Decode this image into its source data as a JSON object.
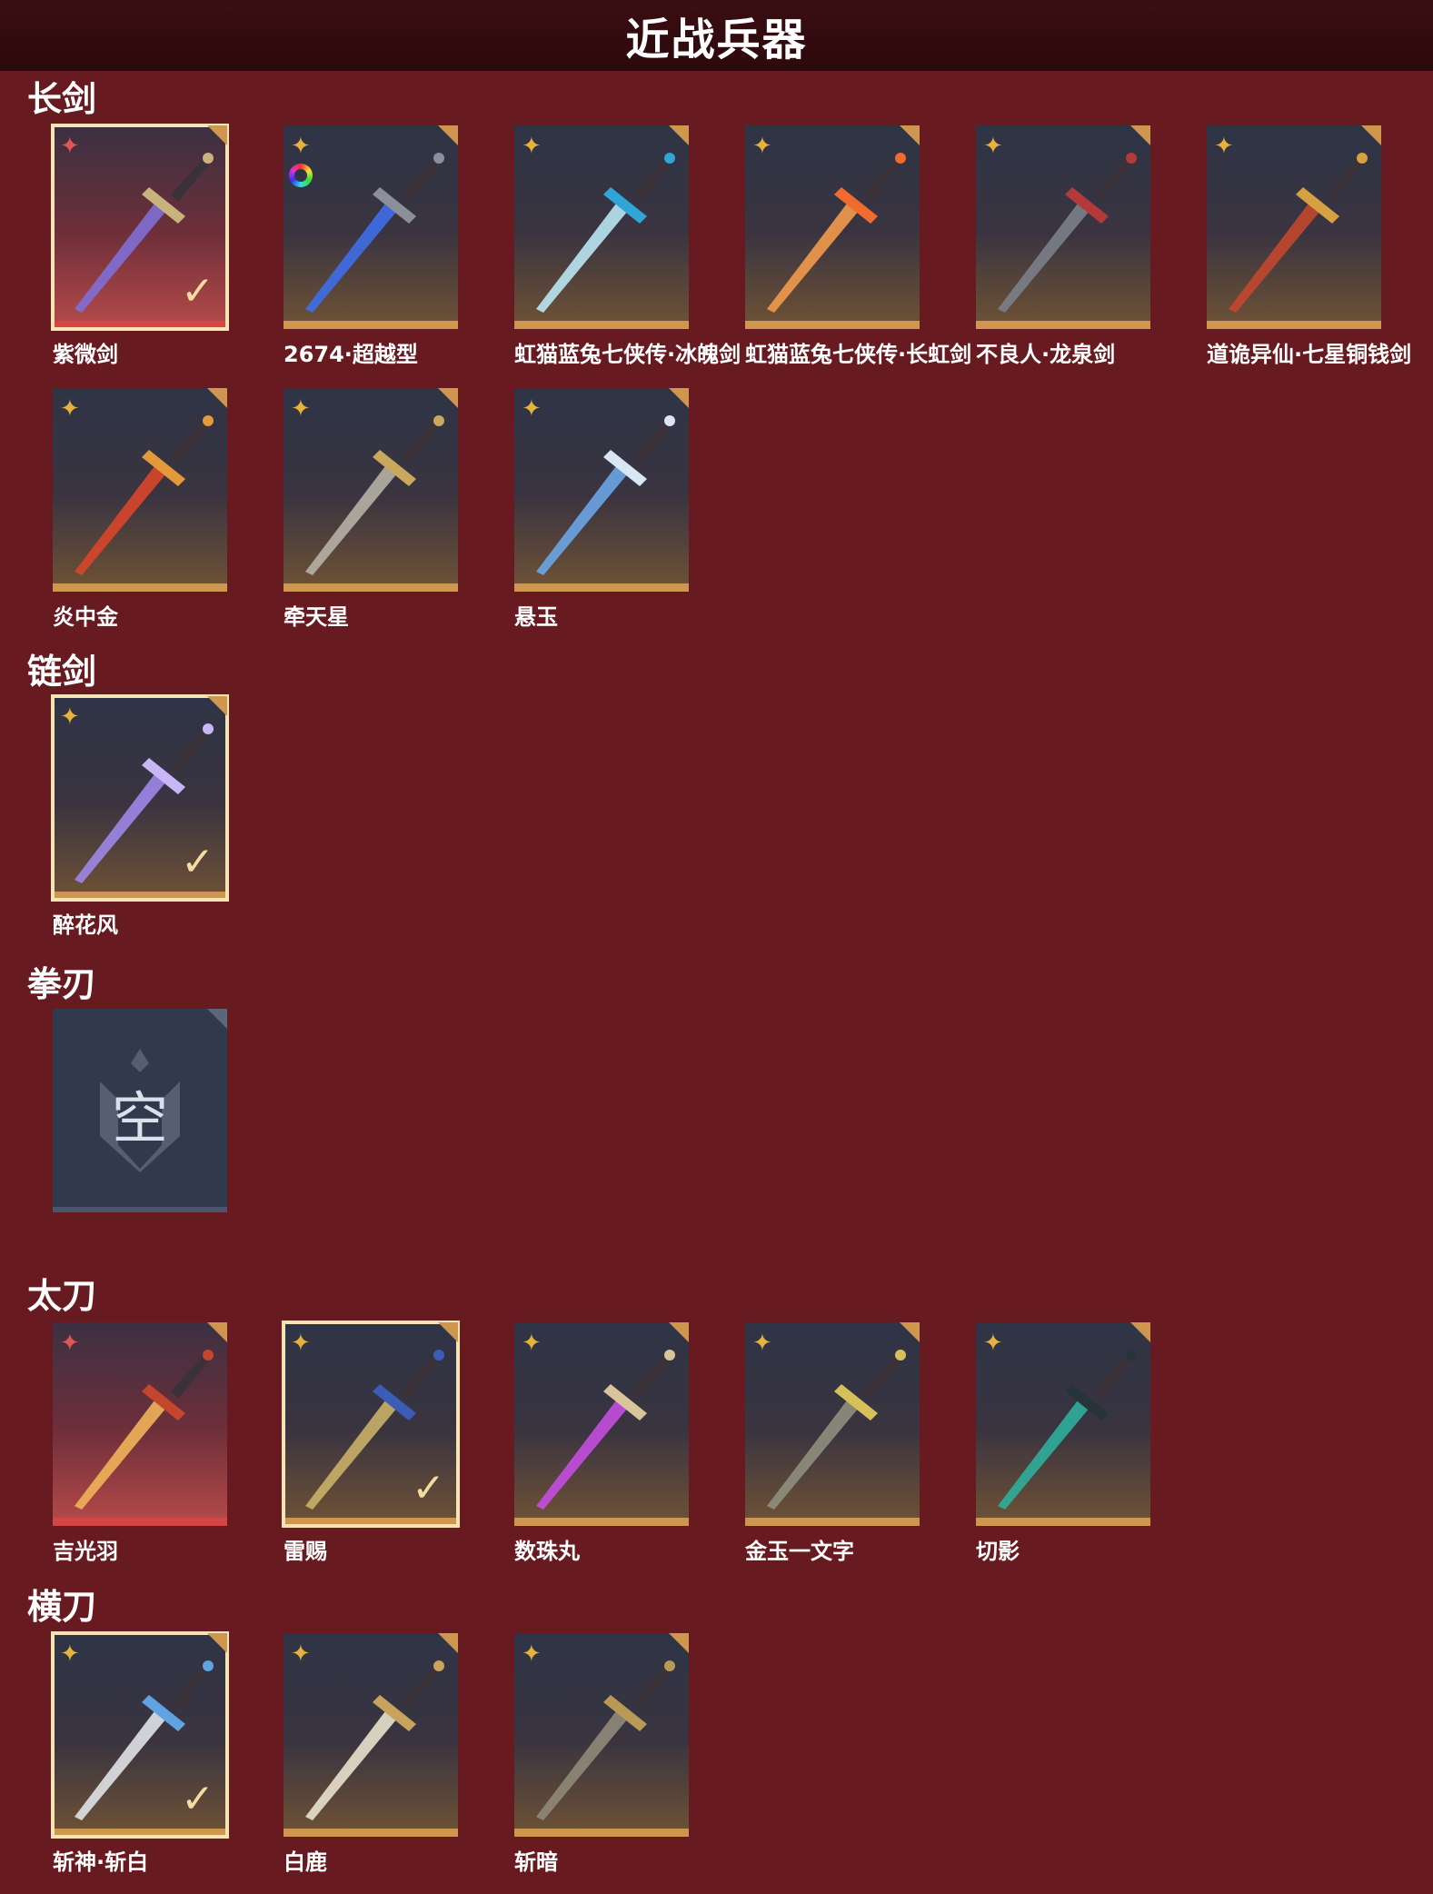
{
  "header": {
    "title": "近战兵器"
  },
  "sections": [
    {
      "title": "长剑",
      "items": [
        {
          "name": "紫微剑",
          "rarity": "red",
          "selected": true,
          "blade": "#7f6fd6",
          "guard": "#c9b37d"
        },
        {
          "name": "2674·超越型",
          "rarity": "gold",
          "selected": false,
          "color_ring": true,
          "blade": "#3f6ee8",
          "guard": "#8a8f9a"
        },
        {
          "name": "虹猫蓝兔七侠传·冰魄剑",
          "rarity": "gold",
          "selected": false,
          "blade": "#b9e6f2",
          "guard": "#2fa6d6"
        },
        {
          "name": "虹猫蓝兔七侠传·长虹剑",
          "rarity": "gold",
          "selected": false,
          "blade": "#f29a4b",
          "guard": "#f06b2d"
        },
        {
          "name": "不良人·龙泉剑",
          "rarity": "gold",
          "selected": false,
          "blade": "#7a7f8a",
          "guard": "#b33a3a"
        },
        {
          "name": "道诡异仙·七星铜钱剑",
          "rarity": "gold",
          "selected": false,
          "blade": "#c2472d",
          "guard": "#d7a040"
        }
      ]
    },
    {
      "title": "",
      "items": [
        {
          "name": "炎中金",
          "rarity": "gold",
          "selected": false,
          "blade": "#d8462b",
          "guard": "#e49a3a"
        },
        {
          "name": "牵天星",
          "rarity": "gold",
          "selected": false,
          "blade": "#b6b0a4",
          "guard": "#c9a75c"
        },
        {
          "name": "悬玉",
          "rarity": "gold",
          "selected": false,
          "blade": "#6ca5e6",
          "guard": "#d8e6f6"
        }
      ]
    },
    {
      "title": "链剑",
      "items": [
        {
          "name": "醉花风",
          "rarity": "gold",
          "selected": true,
          "blade": "#9f86e8",
          "guard": "#c8b6f6"
        }
      ]
    },
    {
      "title": "拳刃",
      "items": [
        {
          "name": "",
          "rarity": "empty",
          "selected": false,
          "empty_label": "空"
        }
      ]
    },
    {
      "title": "太刀",
      "items": [
        {
          "name": "吉光羽",
          "rarity": "red",
          "selected": false,
          "blade": "#f0b25a",
          "guard": "#c6452f"
        },
        {
          "name": "雷赐",
          "rarity": "gold",
          "selected": true,
          "blade": "#c9b068",
          "guard": "#3b5db8"
        },
        {
          "name": "数珠丸",
          "rarity": "gold",
          "selected": false,
          "blade": "#c44ee0",
          "guard": "#d8c59a"
        },
        {
          "name": "金玉一文字",
          "rarity": "gold",
          "selected": false,
          "blade": "#8e8f7d",
          "guard": "#d6c05a"
        },
        {
          "name": "切影",
          "rarity": "gold",
          "selected": false,
          "blade": "#2fae9c",
          "guard": "#27343a"
        }
      ]
    },
    {
      "title": "横刀",
      "items": [
        {
          "name": "斩神·斩白",
          "rarity": "gold",
          "selected": true,
          "blade": "#dfe2e6",
          "guard": "#5fa4e0"
        },
        {
          "name": "白鹿",
          "rarity": "gold",
          "selected": false,
          "blade": "#e8e1cc",
          "guard": "#c8a35c"
        },
        {
          "name": "斩暗",
          "rarity": "gold",
          "selected": false,
          "blade": "#8f8a78",
          "guard": "#b79a55"
        }
      ]
    }
  ]
}
